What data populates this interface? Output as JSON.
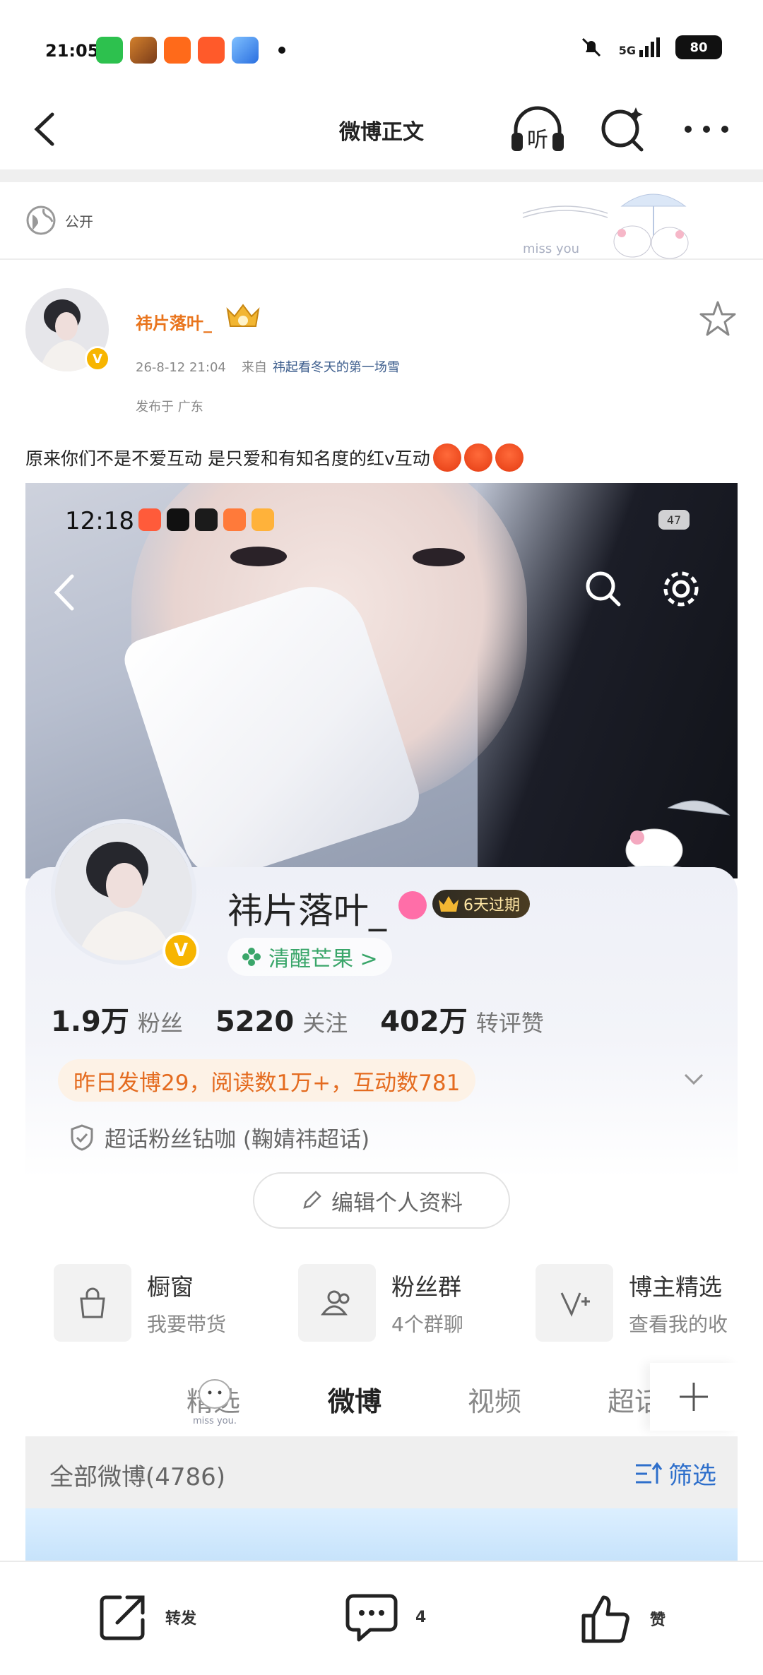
{
  "status_bar": {
    "time": "21:05",
    "network": "5G",
    "battery": "80"
  },
  "nav": {
    "title": "微博正文"
  },
  "visibility": {
    "label": "公开",
    "deco_text": "miss you"
  },
  "post": {
    "author": "祎片落叶_",
    "time": "26-8-12 21:04",
    "source_prefix": "来自",
    "source": "祎起看冬天的第一场雪",
    "location": "发布于 广东",
    "text": "原来你们不是不爱互动 是只爱和有知名度的红v互动"
  },
  "embedded": {
    "time": "12:18",
    "battery": "47",
    "profile": {
      "name": "祎片落叶_",
      "level_badge": "6天过期",
      "tag": "清醒芒果 >",
      "stats": [
        {
          "value": "1.9万",
          "label": "粉丝"
        },
        {
          "value": "5220",
          "label": "关注"
        },
        {
          "value": "402万",
          "label": "转评赞"
        }
      ],
      "activity": "昨日发博29，阅读数1万+，互动数781",
      "super_topic": "超话粉丝钻咖 (鞠婧祎超话)",
      "edit_button": "编辑个人资料"
    },
    "shortcuts": [
      {
        "title": "橱窗",
        "sub": "我要带货"
      },
      {
        "title": "粉丝群",
        "sub": "4个群聊"
      },
      {
        "title": "博主精选",
        "sub": "查看我的收"
      }
    ],
    "tabs": [
      "精选",
      "微博",
      "视频",
      "超话"
    ],
    "tab_mascot_text": "miss you.",
    "filter": {
      "label": "全部微博(4786)",
      "button": "筛选"
    }
  },
  "actions": {
    "repost": "转发",
    "comment_count": "4",
    "like": "赞"
  },
  "colors": {
    "author_orange": "#e9741c",
    "link_blue": "#3b5c8c",
    "activity_orange": "#e46b1f",
    "filter_blue": "#2e6fcb"
  }
}
